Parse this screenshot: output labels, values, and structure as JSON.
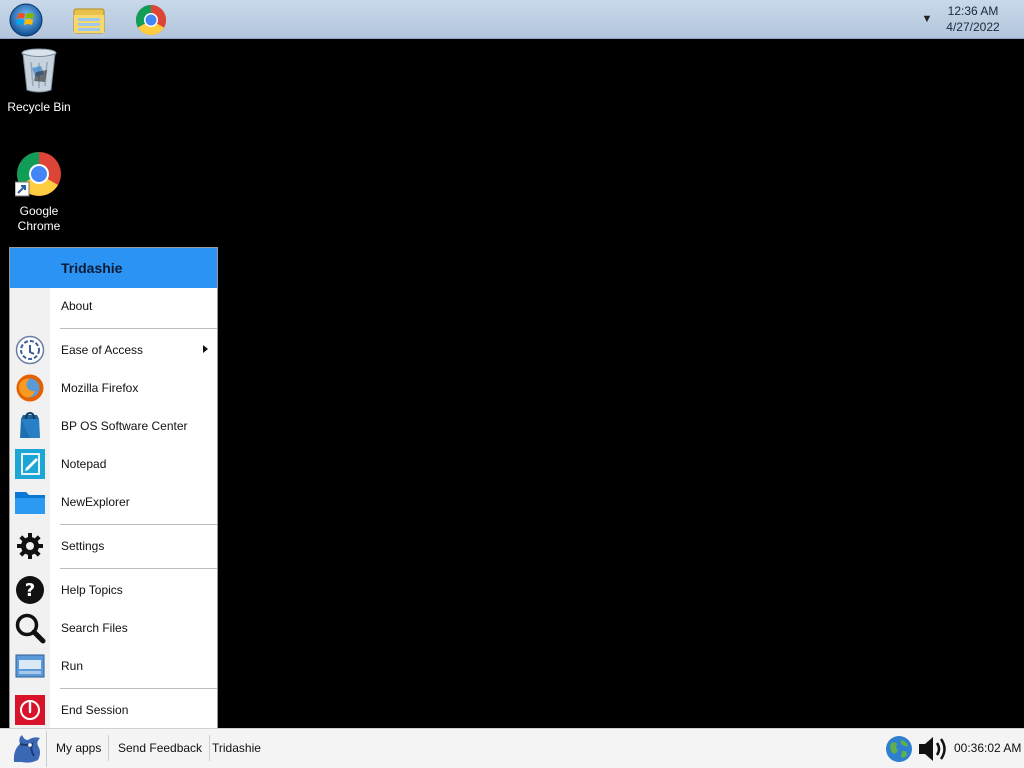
{
  "topbar": {
    "clock_time": "12:36 AM",
    "clock_date": "4/27/2022",
    "icons": [
      "start-orb-icon",
      "file-explorer-icon",
      "chrome-icon",
      "chevron-down-icon"
    ]
  },
  "desktop": {
    "icons": [
      {
        "label": "Recycle Bin",
        "icon": "recycle-bin-icon"
      },
      {
        "label": "Google Chrome",
        "icon": "chrome-icon"
      }
    ]
  },
  "start_menu": {
    "header": "Tridashie",
    "items": [
      {
        "label": "About",
        "icon": ""
      },
      {
        "label": "Ease of Access",
        "icon": "ease-of-access-icon",
        "submenu": true
      },
      {
        "label": "Mozilla Firefox",
        "icon": "firefox-icon"
      },
      {
        "label": "BP OS Software Center",
        "icon": "software-center-icon"
      },
      {
        "label": "Notepad",
        "icon": "notepad-icon"
      },
      {
        "label": "NewExplorer",
        "icon": "folder-icon"
      },
      {
        "label": "Settings",
        "icon": "gear-icon"
      },
      {
        "label": "Help Topics",
        "icon": "help-icon"
      },
      {
        "label": "Search Files",
        "icon": "search-icon"
      },
      {
        "label": "Run",
        "icon": "run-icon"
      },
      {
        "label": "End Session",
        "icon": "power-icon"
      }
    ]
  },
  "taskbar": {
    "buttons": [
      "My apps",
      "Send Feedback",
      "Tridashie"
    ],
    "timer": "00:36:02 AM",
    "icons": [
      "start-icon",
      "globe-icon",
      "volume-icon"
    ]
  },
  "colors": {
    "menu_header": "#2a93f4",
    "desktop": "#000000",
    "topbar": "#c9d8ea",
    "taskbar": "#f4f4f4"
  }
}
